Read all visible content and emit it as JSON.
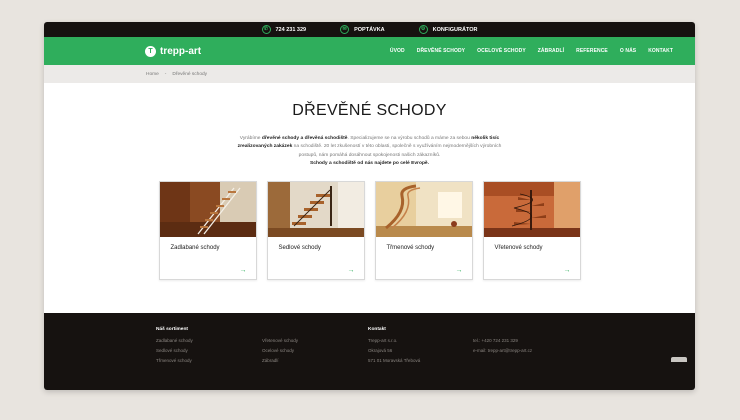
{
  "topbar": {
    "phone": "724 231 329",
    "inquiry": "POPTÁVKA",
    "configurator": "KONFIGURÁTOR"
  },
  "nav": {
    "logo": "trepp-art",
    "items": [
      "ÚVOD",
      "DŘEVĚNÉ SCHODY",
      "OCELOVÉ SCHODY",
      "ZÁBRADLÍ",
      "REFERENCE",
      "O NÁS",
      "KONTAKT"
    ]
  },
  "breadcrumb": {
    "home": "Home",
    "separator": "-",
    "current": "Dřevěné schody"
  },
  "main": {
    "title": "DŘEVĚNÉ SCHODY",
    "intro": {
      "t1": "Vyrábíme ",
      "b1": "dřevěné schody a dřevěná schodiště",
      "t2": ". Specializujeme se na výrobu schodů a máme za sebou ",
      "b2": "několik tisíc zrealizovaných zakázek",
      "t3": " na schodiště. 20 let zkušeností v této oblasti, společně s využíváním nejmodernějších výrobních postupů, nám pomáhá dosáhnout spokojenosti našich zákazníků.",
      "b3": "Schody a schodiště od nás najdete po celé Evropě."
    },
    "cards": [
      {
        "label": "Zadlabané schody",
        "arrow": "→"
      },
      {
        "label": "Sedlové schody",
        "arrow": "→"
      },
      {
        "label": "Třmenové schody",
        "arrow": "→"
      },
      {
        "label": "Vřetenové schody",
        "arrow": "→"
      }
    ]
  },
  "footer": {
    "assortment_heading": "Náš sortiment",
    "col1": [
      "Zadlabané schody",
      "Sedlové schody",
      "Třmenové schody"
    ],
    "col2": [
      "Vřetenové schody",
      "Ocelové schody",
      "Zábradlí"
    ],
    "contact_heading": "Kontakt",
    "col3": [
      "Trepp-art s.r.o.",
      "Okrajová 56",
      "571 01 Moravská Třebová"
    ],
    "col4": [
      "tel.: +420 724 231 329",
      "e-mail: trepp-art@trepp-art.cz"
    ]
  },
  "colors": {
    "brand_green": "#2fae5c",
    "dark": "#161210"
  },
  "icons": {
    "phone": "phone-icon",
    "inquiry": "envelope-icon",
    "configurator": "gear-icon",
    "card_arrow": "arrow-right-icon"
  }
}
